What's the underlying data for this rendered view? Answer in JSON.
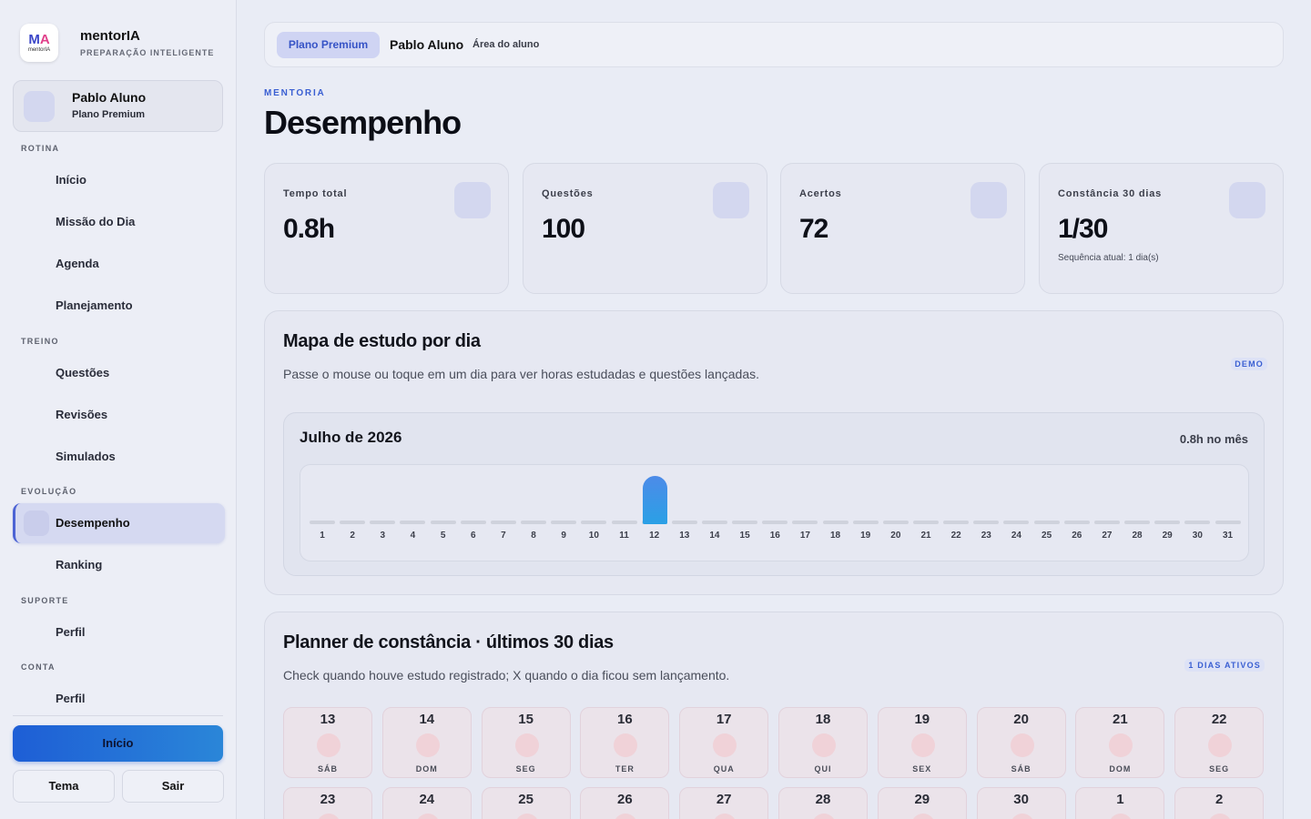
{
  "brand": {
    "name": "mentorIA",
    "tagline": "PREPARAÇÃO INTELIGENTE",
    "logo_text": "mentorIA"
  },
  "user": {
    "name": "Pablo Aluno",
    "plan": "Plano Premium"
  },
  "nav": {
    "sections": [
      {
        "title": "ROTINA",
        "items": [
          "Início",
          "Missão do Dia",
          "Agenda",
          "Planejamento"
        ]
      },
      {
        "title": "TREINO",
        "items": [
          "Questões",
          "Revisões",
          "Simulados"
        ]
      },
      {
        "title": "EVOLUÇÃO",
        "items": [
          "Desempenho",
          "Ranking"
        ]
      },
      {
        "title": "SUPORTE",
        "items": [
          "Perfil"
        ]
      },
      {
        "title": "CONTA",
        "items": [
          "Perfil"
        ]
      }
    ],
    "active": "Desempenho"
  },
  "footer": {
    "primary": "Início",
    "theme": "Tema",
    "logout": "Sair"
  },
  "topbar": {
    "plan_pill": "Plano Premium",
    "user": "Pablo Aluno",
    "area": "Área do aluno"
  },
  "page": {
    "kicker": "MENTORIA",
    "title": "Desempenho"
  },
  "stats": [
    {
      "label": "Tempo total",
      "value": "0.8h",
      "sub": ""
    },
    {
      "label": "Questões",
      "value": "100",
      "sub": ""
    },
    {
      "label": "Acertos",
      "value": "72",
      "sub": ""
    },
    {
      "label": "Constância 30 dias",
      "value": "1/30",
      "sub": "Sequência atual: 1 dia(s)"
    }
  ],
  "study_map": {
    "title": "Mapa de estudo por dia",
    "description": "Passe o mouse ou toque em um dia para ver horas estudadas e questões lançadas.",
    "tag": "DEMO",
    "month": "Julho de 2026",
    "month_total": "0.8h no mês",
    "accent": "#2f8ee6"
  },
  "chart_data": {
    "type": "bar",
    "categories": [
      "1",
      "2",
      "3",
      "4",
      "5",
      "6",
      "7",
      "8",
      "9",
      "10",
      "11",
      "12",
      "13",
      "14",
      "15",
      "16",
      "17",
      "18",
      "19",
      "20",
      "21",
      "22",
      "23",
      "24",
      "25",
      "26",
      "27",
      "28",
      "29",
      "30",
      "31"
    ],
    "values": [
      0,
      0,
      0,
      0,
      0,
      0,
      0,
      0,
      0,
      0,
      0,
      0.8,
      0,
      0,
      0,
      0,
      0,
      0,
      0,
      0,
      0,
      0,
      0,
      0,
      0,
      0,
      0,
      0,
      0,
      0,
      0
    ],
    "title": "Julho de 2026",
    "xlabel": "",
    "ylabel": ""
  },
  "planner": {
    "title": "Planner de constância · últimos 30 dias",
    "description": "Check quando houve estudo registrado; X quando o dia ficou sem lançamento.",
    "tag": "1 DIAS ATIVOS",
    "days": [
      {
        "num": "13",
        "weekday": "SÁB"
      },
      {
        "num": "14",
        "weekday": "DOM"
      },
      {
        "num": "15",
        "weekday": "SEG"
      },
      {
        "num": "16",
        "weekday": "TER"
      },
      {
        "num": "17",
        "weekday": "QUA"
      },
      {
        "num": "18",
        "weekday": "QUI"
      },
      {
        "num": "19",
        "weekday": "SEX"
      },
      {
        "num": "20",
        "weekday": "SÁB"
      },
      {
        "num": "21",
        "weekday": "DOM"
      },
      {
        "num": "22",
        "weekday": "SEG"
      },
      {
        "num": "23",
        "weekday": ""
      },
      {
        "num": "24",
        "weekday": ""
      },
      {
        "num": "25",
        "weekday": ""
      },
      {
        "num": "26",
        "weekday": ""
      },
      {
        "num": "27",
        "weekday": ""
      },
      {
        "num": "28",
        "weekday": ""
      },
      {
        "num": "29",
        "weekday": ""
      },
      {
        "num": "30",
        "weekday": ""
      },
      {
        "num": "1",
        "weekday": ""
      },
      {
        "num": "2",
        "weekday": ""
      }
    ]
  }
}
